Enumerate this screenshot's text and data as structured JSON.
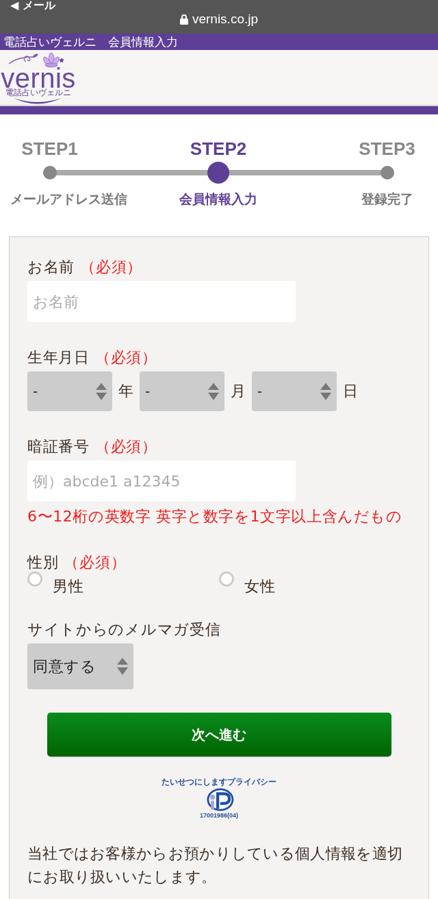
{
  "status_bar": {
    "back_label": "◀ メール",
    "url": "vernis.co.jp"
  },
  "page_title_bar": {
    "text": "電話占いヴェルニ　会員情報入力"
  },
  "logo": {
    "wordmark": "vernis",
    "tagline": "電話占いヴェルニ"
  },
  "steps": [
    {
      "title": "STEP1",
      "label": "メールアドレス送信",
      "active": false
    },
    {
      "title": "STEP2",
      "label": "会員情報入力",
      "active": true
    },
    {
      "title": "STEP3",
      "label": "登録完了",
      "active": false
    }
  ],
  "form": {
    "fields": [
      {
        "kind": "text",
        "label": "お名前",
        "required_mark": "（必須）",
        "placeholder": "お名前"
      },
      {
        "kind": "date",
        "label": "生年月日",
        "required_mark": "（必須）",
        "parts": [
          {
            "value": "-",
            "unit": "年"
          },
          {
            "value": "-",
            "unit": "月"
          },
          {
            "value": "-",
            "unit": "日"
          }
        ]
      },
      {
        "kind": "text",
        "label": "暗証番号",
        "required_mark": "（必須）",
        "placeholder": "例）abcde1 a12345",
        "hint": "6〜12桁の英数字 英字と数字を1文字以上含んだもの"
      },
      {
        "kind": "radio",
        "label": "性別",
        "required_mark": "（必須）",
        "options": [
          {
            "label": "男性",
            "checked": false
          },
          {
            "label": "女性",
            "checked": false
          }
        ]
      },
      {
        "kind": "select",
        "label": "サイトからのメルマガ受信",
        "value": "同意する"
      }
    ],
    "submit_button": "次へ進む",
    "privacy_mark": {
      "caption": "たいせつにしますプライバシー",
      "number": "17001986(04)"
    },
    "notice": "当社ではお客様からお預かりしている個人情報を適切にお取り扱いいたします。"
  }
}
